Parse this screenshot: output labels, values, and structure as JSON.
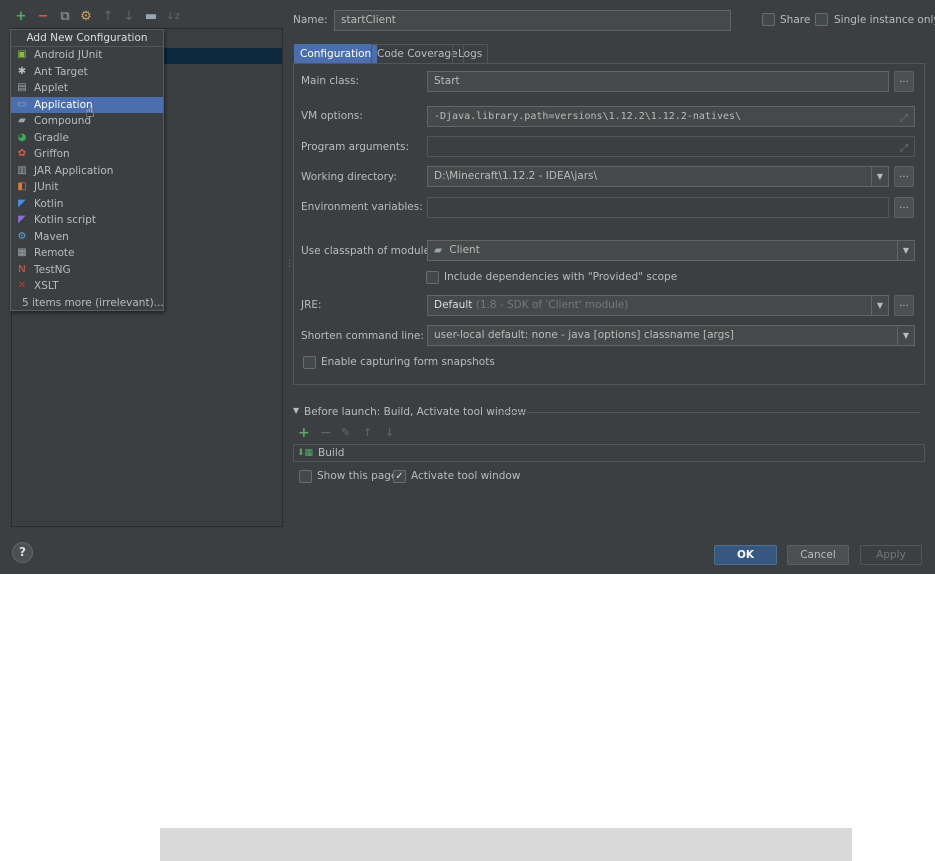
{
  "toolbar": {
    "add": "+",
    "remove": "−",
    "copy": "⧉",
    "settings": "⚙",
    "up": "↑",
    "down": "↓",
    "folder": "▬",
    "sort": "↓z"
  },
  "add_config_popup": {
    "title": "Add New Configuration",
    "items": [
      {
        "label": "Android JUnit",
        "icon": "android-junit-icon",
        "glyph": "▣",
        "color": "#8cbf3f"
      },
      {
        "label": "Ant Target",
        "icon": "ant-icon",
        "glyph": "✱",
        "color": "#bbbbbb"
      },
      {
        "label": "Applet",
        "icon": "applet-icon",
        "glyph": "▤",
        "color": "#9aa7b0"
      },
      {
        "label": "Application",
        "icon": "application-icon",
        "glyph": "▭",
        "color": "#9aa7b0"
      },
      {
        "label": "Compound",
        "icon": "folder-icon",
        "glyph": "▰",
        "color": "#9aa7b0"
      },
      {
        "label": "Gradle",
        "icon": "gradle-icon",
        "glyph": "◕",
        "color": "#3ea862"
      },
      {
        "label": "Griffon",
        "icon": "griffon-icon",
        "glyph": "✿",
        "color": "#e05a4e"
      },
      {
        "label": "JAR Application",
        "icon": "jar-icon",
        "glyph": "▥",
        "color": "#9aa7b0"
      },
      {
        "label": "JUnit",
        "icon": "junit-icon",
        "glyph": "◧",
        "color": "#d67c3a"
      },
      {
        "label": "Kotlin",
        "icon": "kotlin-icon",
        "glyph": "◤",
        "color": "#4e8fe6"
      },
      {
        "label": "Kotlin script",
        "icon": "kotlin-script-icon",
        "glyph": "◤",
        "color": "#8a6fd6"
      },
      {
        "label": "Maven",
        "icon": "maven-icon",
        "glyph": "⚙",
        "color": "#5ca6dd"
      },
      {
        "label": "Remote",
        "icon": "remote-icon",
        "glyph": "▦",
        "color": "#9aa7b0"
      },
      {
        "label": "TestNG",
        "icon": "testng-icon",
        "glyph": "N",
        "color": "#e05a4e"
      },
      {
        "label": "XSLT",
        "icon": "xslt-icon",
        "glyph": "✕",
        "color": "#c0392b"
      },
      {
        "label": "5 items more (irrelevant)...",
        "icon": "",
        "glyph": "",
        "color": "#bbbbbb"
      }
    ],
    "selected_index": 3
  },
  "header": {
    "name_label": "Name:",
    "name_value": "startClient",
    "share_label": "Share",
    "single_instance_label": "Single instance only"
  },
  "tabs": [
    "Configuration",
    "Code Coverage",
    "Logs"
  ],
  "config": {
    "main_class_label": "Main class:",
    "main_class_value": "Start",
    "vm_options_label": "VM options:",
    "vm_options_value": "-Djava.library.path=versions\\1.12.2\\1.12.2-natives\\",
    "program_args_label": "Program arguments:",
    "program_args_value": "",
    "working_dir_label": "Working directory:",
    "working_dir_value": "D:\\Minecraft\\1.12.2 - IDEA\\jars\\",
    "env_vars_label": "Environment variables:",
    "env_vars_value": "",
    "classpath_label": "Use classpath of module:",
    "classpath_value": "Client",
    "include_deps_label": "Include dependencies with \"Provided\" scope",
    "jre_label": "JRE:",
    "jre_value": "Default",
    "jre_hint": "(1.8 - SDK of 'Client' module)",
    "shorten_label": "Shorten command line:",
    "shorten_value": "user-local default: none - java [options] classname [args]",
    "snapshots_label": "Enable capturing form snapshots",
    "dots": "..."
  },
  "before_launch": {
    "title": "Before launch: Build, Activate tool window",
    "tasks": [
      "Build"
    ],
    "show_page_label": "Show this page",
    "activate_label": "Activate tool window",
    "activate_checked": true
  },
  "footer": {
    "help": "?",
    "ok": "OK",
    "cancel": "Cancel",
    "apply": "Apply"
  }
}
